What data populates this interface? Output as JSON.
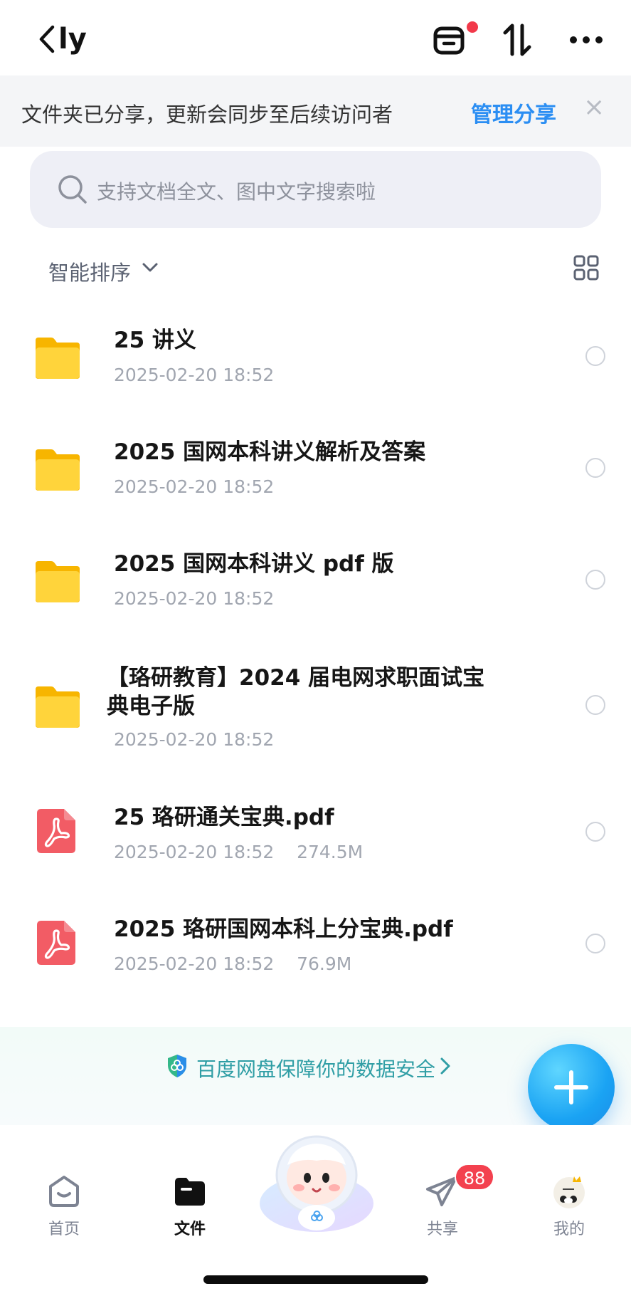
{
  "header": {
    "back_icon": "chevron-left-icon",
    "title": "ly",
    "icons": [
      "transfer-box-icon",
      "sort-updown-icon",
      "more-icon"
    ],
    "notification_dot_color": "#f2394a"
  },
  "share_banner": {
    "message": "文件夹已分享，更新会同步至后续访问者",
    "action_label": "管理分享",
    "close_label": "×"
  },
  "search": {
    "placeholder": "支持文档全文、图中文字搜索啦"
  },
  "sort": {
    "label": "智能排序",
    "view_toggle_icon": "grid-view-icon"
  },
  "files": [
    {
      "name": "25 讲义",
      "meta": "2025-02-20 18:52",
      "type": "folder"
    },
    {
      "name": "2025 国网本科讲义解析及答案",
      "meta": "2025-02-20 18:52",
      "type": "folder"
    },
    {
      "name": "2025 国网本科讲义 pdf 版",
      "meta": "2025-02-20 18:52",
      "type": "folder"
    },
    {
      "name": "【珞研教育】2024 届电网求职面试宝典电子版",
      "meta": "2025-02-20 18:52",
      "type": "folder"
    },
    {
      "name": "25 珞研通关宝典.pdf",
      "meta": "2025-02-20 18:52    274.5M",
      "type": "pdf"
    },
    {
      "name": "2025 珞研国网本科上分宝典.pdf",
      "meta": "2025-02-20 18:52    76.9M",
      "type": "pdf"
    }
  ],
  "security_notice": {
    "text": "百度网盘保障你的数据安全"
  },
  "fab": {
    "icon": "plus-icon"
  },
  "tabbar": {
    "items": [
      {
        "label": "首页",
        "icon": "home-icon",
        "active": false
      },
      {
        "label": "文件",
        "icon": "folder-icon",
        "active": true
      },
      {
        "label": "共享",
        "icon": "send-icon",
        "active": false
      },
      {
        "label": "我的",
        "icon": "avatar-icon",
        "active": false
      }
    ],
    "share_badge": "88"
  },
  "colors": {
    "accent": "#2b8ef3",
    "folder": "#fcc419",
    "pdf": "#f25c65",
    "secure_text": "#2f9ea5"
  }
}
